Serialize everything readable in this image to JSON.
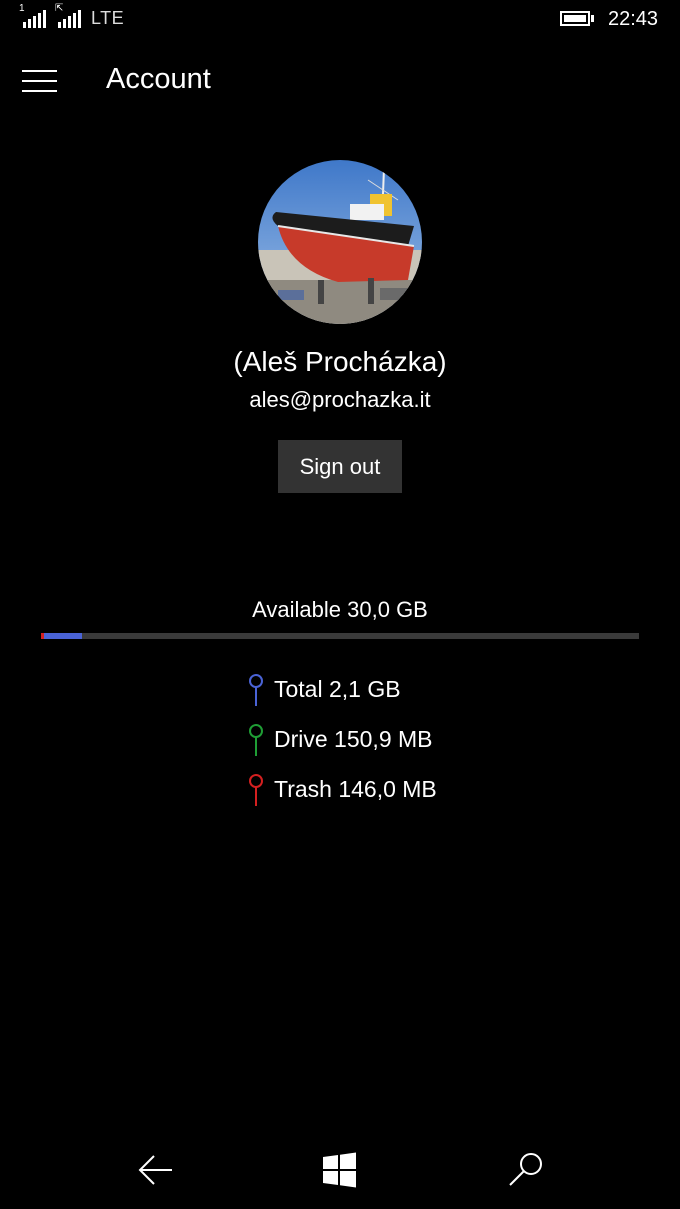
{
  "status_bar": {
    "sim1_label": "1",
    "sim2_label": "⇱",
    "network": "LTE",
    "time": "22:43",
    "battery_icon": "battery-full-icon",
    "signal_icon": "signal-bars-icon"
  },
  "header": {
    "menu_icon": "hamburger-menu-icon",
    "title": "Account"
  },
  "profile": {
    "avatar_desc": "boat-photo-avatar",
    "name": "(Aleš Procházka)",
    "email": "ales@prochazka.it",
    "sign_out_label": "Sign out"
  },
  "storage": {
    "available_label": "Available 30,0 GB",
    "usage_fraction_trash": 0.002,
    "usage_fraction_total": 0.068,
    "legend": [
      {
        "label": "Total 2,1 GB",
        "color": "#4a63d6"
      },
      {
        "label": "Drive 150,9 MB",
        "color": "#1f9e35"
      },
      {
        "label": "Trash 146,0 MB",
        "color": "#d42020"
      }
    ]
  },
  "nav": {
    "back_icon": "back-arrow-icon",
    "home_icon": "windows-logo-icon",
    "search_icon": "search-icon"
  }
}
